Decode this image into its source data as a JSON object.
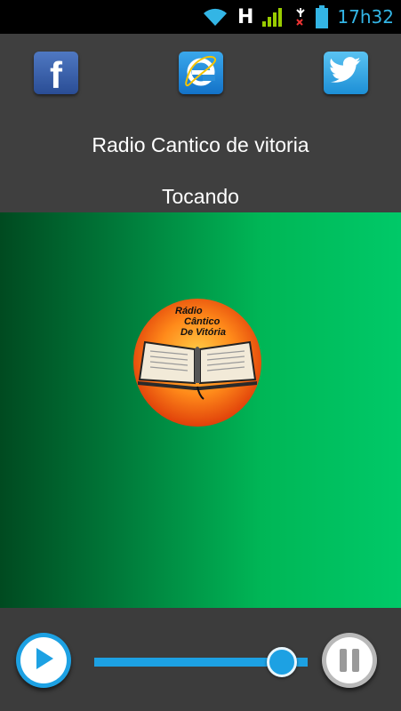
{
  "status_bar": {
    "time": "17h32",
    "network_type": "H",
    "icons": [
      "wifi-icon",
      "signal-icon",
      "no-sim-icon",
      "battery-icon"
    ],
    "accent_color": "#33b5e5"
  },
  "social": {
    "facebook_letter": "f",
    "icons": [
      "facebook-icon",
      "internet-explorer-icon",
      "twitter-icon"
    ]
  },
  "station": {
    "name": "Radio Cantico de vitoria",
    "status": "Tocando"
  },
  "logo": {
    "line1": "Rádio",
    "line2": "Cântico",
    "line3": "De Vitória"
  },
  "player": {
    "volume_fraction": 0.88,
    "accent_color": "#1da1e3"
  },
  "artwork": {
    "gradient_dark": "#004a20",
    "gradient_light": "#00c968"
  }
}
